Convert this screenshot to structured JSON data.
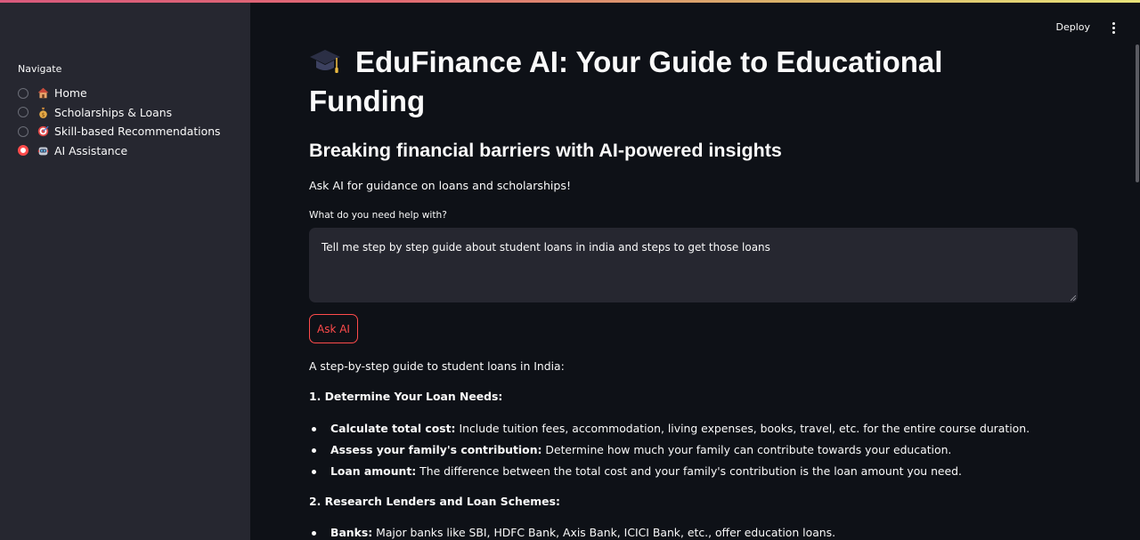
{
  "sidebar": {
    "title": "Navigate",
    "items": [
      {
        "emoji": "house",
        "label": "Home",
        "selected": false
      },
      {
        "emoji": "money-bag",
        "label": "Scholarships & Loans",
        "selected": false
      },
      {
        "emoji": "target",
        "label": "Skill-based Recommendations",
        "selected": false
      },
      {
        "emoji": "robot",
        "label": "AI Assistance",
        "selected": true
      }
    ]
  },
  "toolbar": {
    "deploy_label": "Deploy"
  },
  "page": {
    "title_line1": "EduFinance AI: Your Guide to Educational",
    "title_line2": "Funding",
    "title_icon": "graduation-cap-icon",
    "subtitle": "Breaking financial barriers with AI-powered insights",
    "intro": "Ask AI for guidance on loans and scholarships!",
    "input_label": "What do you need help with?",
    "input_value": "Tell me step by step guide about student loans in india and steps to get those loans",
    "ask_button": "Ask AI"
  },
  "answer": {
    "lead": "A step-by-step guide to student loans in India:",
    "section1_title": "1. Determine Your Loan Needs:",
    "section1_items": [
      {
        "bold": "Calculate total cost:",
        "text": " Include tuition fees, accommodation, living expenses, books, travel, etc. for the entire course duration."
      },
      {
        "bold": "Assess your family's contribution:",
        "text": " Determine how much your family can contribute towards your education."
      },
      {
        "bold": "Loan amount:",
        "text": " The difference between the total cost and your family's contribution is the loan amount you need."
      }
    ],
    "section2_title": "2. Research Lenders and Loan Schemes:",
    "section2_items": [
      {
        "bold": "Banks:",
        "text": " Major banks like SBI, HDFC Bank, Axis Bank, ICICI Bank, etc., offer education loans."
      }
    ]
  },
  "colors": {
    "background": "#0e1117",
    "sidebar": "#262730",
    "accent": "#ff4b4b",
    "text": "#fafafa"
  }
}
